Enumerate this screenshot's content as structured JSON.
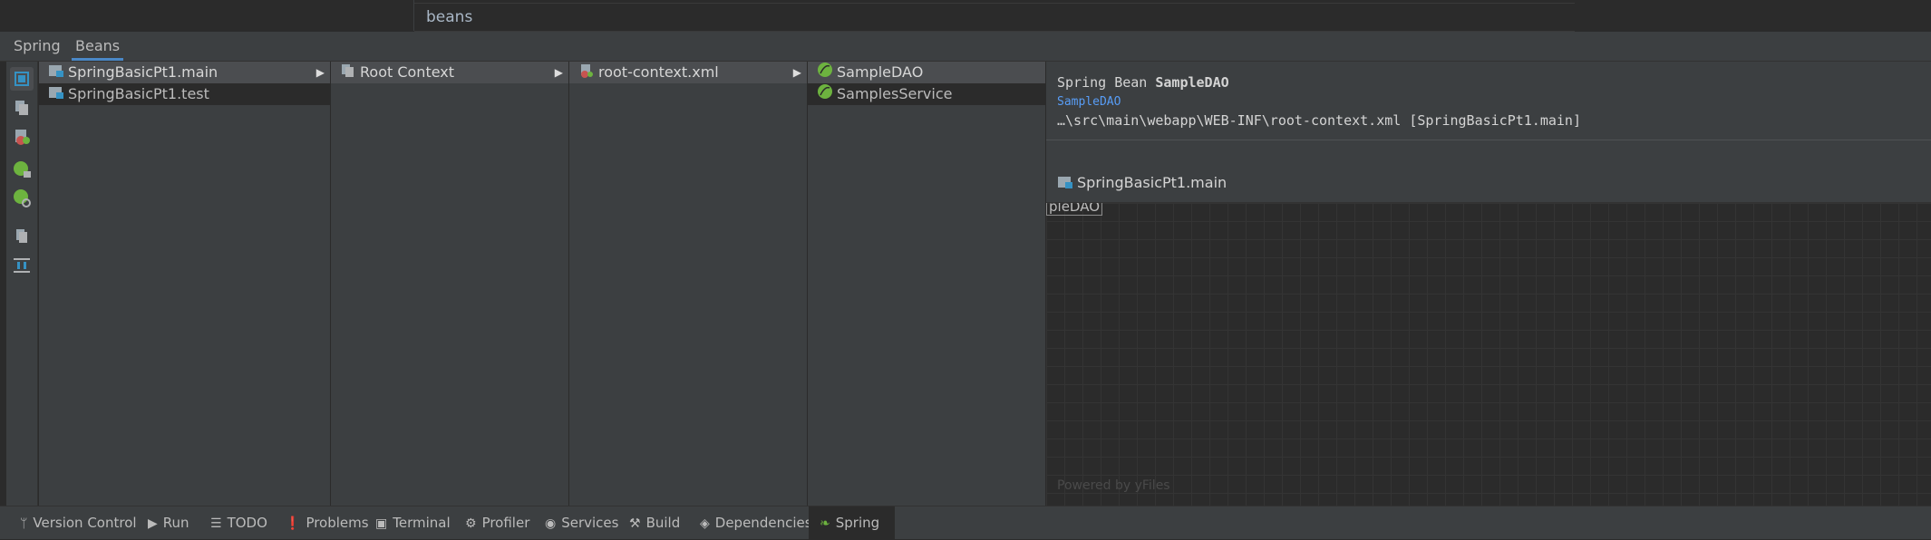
{
  "window": {
    "title": "beans"
  },
  "tabs": [
    {
      "label": "Spring",
      "active": false
    },
    {
      "label": "Beans",
      "active": true
    }
  ],
  "toolbar": {
    "icons": [
      "select-icon",
      "copy-icon",
      "xml-config-icon",
      "bean-lock-icon",
      "bean-settings-icon",
      "documents-icon",
      "layout-icon"
    ]
  },
  "columns": {
    "modules": [
      {
        "label": "SpringBasicPt1.main",
        "selected": true,
        "arrow": "▶"
      },
      {
        "label": "SpringBasicPt1.test",
        "selected": false
      }
    ],
    "contexts": [
      {
        "label": "Root Context",
        "selected": true,
        "arrow": "▶"
      }
    ],
    "files": [
      {
        "label": "root-context.xml",
        "selected": true,
        "arrow": "▶"
      }
    ],
    "beans": [
      {
        "label": "SampleDAO",
        "selected": true
      },
      {
        "label": "SamplesService",
        "selected": false
      }
    ]
  },
  "popup": {
    "prefix": "Spring Bean ",
    "bean_name": "SampleDAO",
    "link": "SampleDAO",
    "path": "…\\src\\main\\webapp\\WEB-INF\\root-context.xml [SpringBasicPt1.main]",
    "module": "SpringBasicPt1.main"
  },
  "diagram": {
    "node_label": "pleDAO",
    "watermark": "Powered by yFiles"
  },
  "statusbar": {
    "items": [
      {
        "label": "Version Control",
        "icon": "branch-icon"
      },
      {
        "label": "Run",
        "icon": "run-icon"
      },
      {
        "label": "TODO",
        "icon": "todo-icon"
      },
      {
        "label": "Problems",
        "icon": "problems-icon"
      },
      {
        "label": "Terminal",
        "icon": "terminal-icon"
      },
      {
        "label": "Profiler",
        "icon": "profiler-icon"
      },
      {
        "label": "Services",
        "icon": "services-icon"
      },
      {
        "label": "Build",
        "icon": "build-icon"
      },
      {
        "label": "Dependencies",
        "icon": "dependencies-icon"
      },
      {
        "label": "Spring",
        "icon": "spring-leaf-icon",
        "active": true
      }
    ]
  },
  "colors": {
    "accent": "#4a88c7",
    "spring_green": "#6db33f",
    "link": "#589df6"
  }
}
